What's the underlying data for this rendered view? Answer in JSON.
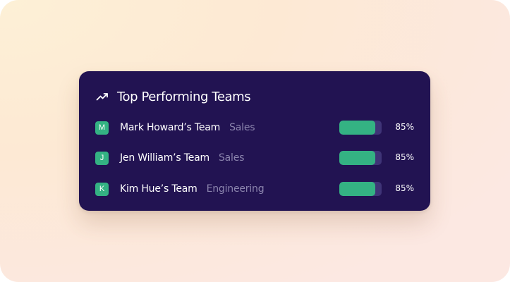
{
  "widget": {
    "title": "Top Performing Teams",
    "icon": "trending-up-icon",
    "accent_color": "#34b283",
    "card_color": "#221352"
  },
  "teams": [
    {
      "initial": "M",
      "name": "Mark Howard’s Team",
      "department": "Sales",
      "percent_label": "85%",
      "progress": 0.85
    },
    {
      "initial": "J",
      "name": "Jen William’s Team",
      "department": "Sales",
      "percent_label": "85%",
      "progress": 0.85
    },
    {
      "initial": "K",
      "name": "Kim Hue’s Team",
      "department": "Engineering",
      "percent_label": "85%",
      "progress": 0.85
    }
  ]
}
